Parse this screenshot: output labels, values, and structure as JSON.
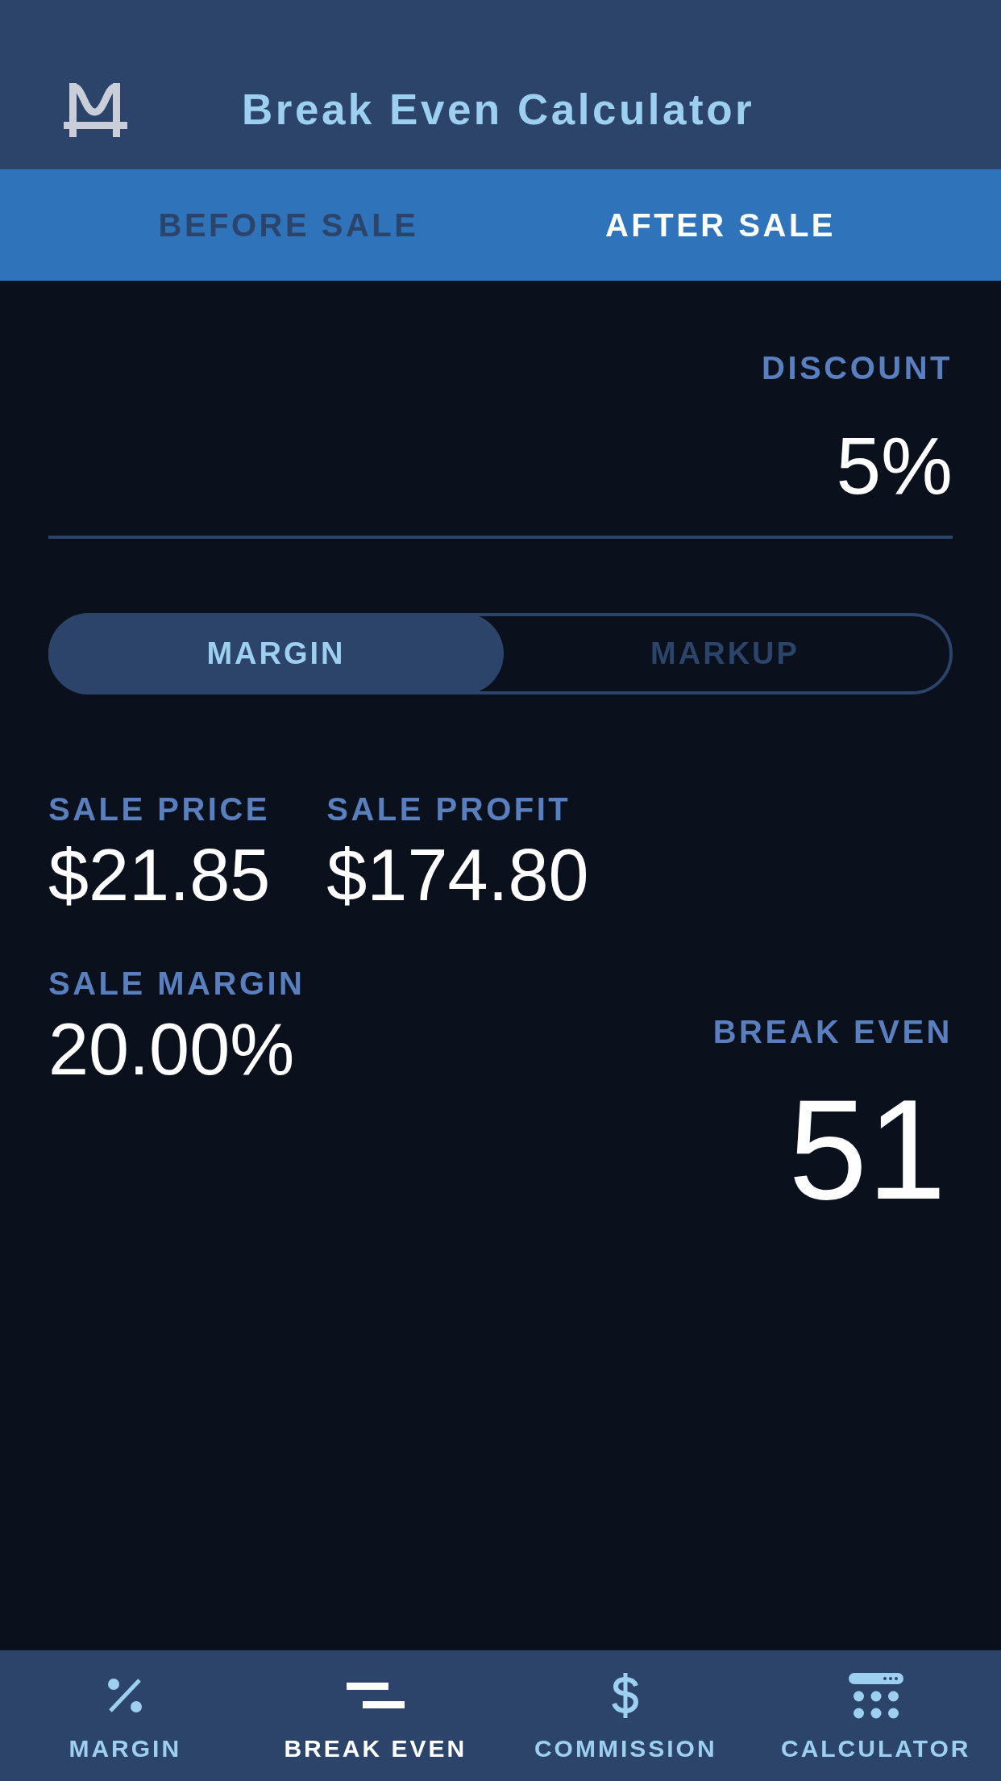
{
  "header": {
    "title": "Break Even Calculator"
  },
  "tabs": [
    {
      "label": "BEFORE SALE",
      "selected": false
    },
    {
      "label": "AFTER SALE",
      "selected": true
    }
  ],
  "discount": {
    "label": "DISCOUNT",
    "value": "5%"
  },
  "mode_toggle": [
    {
      "label": "MARGIN",
      "selected": true
    },
    {
      "label": "MARKUP",
      "selected": false
    }
  ],
  "stats": [
    {
      "label": "SALE PRICE",
      "value": "$21.85"
    },
    {
      "label": "SALE PROFIT",
      "value": "$174.80"
    },
    {
      "label": "SALE MARGIN",
      "value": "20.00%"
    }
  ],
  "break_even": {
    "label": "BREAK EVEN",
    "value": "51"
  },
  "bottom_nav": [
    {
      "label": "MARGIN",
      "selected": false
    },
    {
      "label": "BREAK EVEN",
      "selected": true
    },
    {
      "label": "COMMISSION",
      "selected": false
    },
    {
      "label": "CALCULATOR",
      "selected": false
    }
  ]
}
